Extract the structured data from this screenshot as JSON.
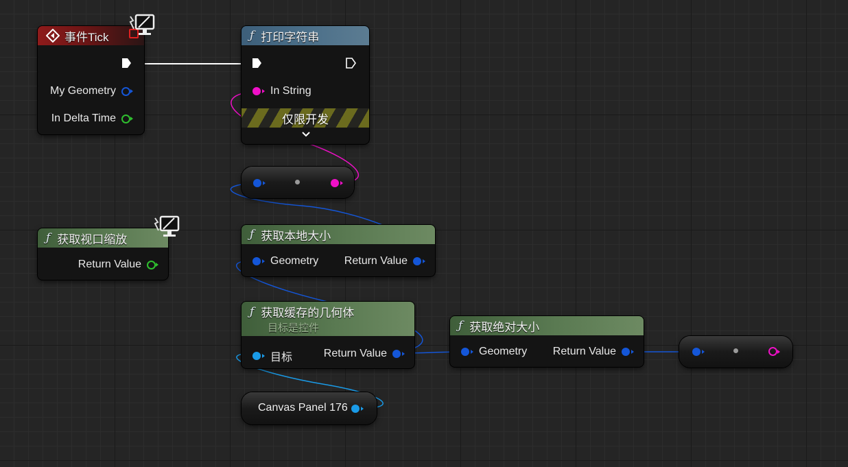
{
  "colors": {
    "exec_wire": "#ffffff",
    "string_wire": "#f010c8",
    "geometry_wire": "#1456d8",
    "object_wire": "#1a9be8",
    "float_pin": "#2fc02f"
  },
  "nodes": {
    "event_tick": {
      "title": "事件Tick",
      "icon": "event-diamond-icon",
      "pins": {
        "geometry": "My Geometry",
        "delta_time": "In Delta Time"
      }
    },
    "print_string": {
      "title": "打印字符串",
      "pins": {
        "in_string": "In String"
      },
      "dev_only_label": "仅限开发",
      "expand_icon": "chevron-down-icon"
    },
    "get_viewport_scale": {
      "title": "获取视口缩放",
      "pins": {
        "return_value": "Return Value"
      }
    },
    "get_local_size": {
      "title": "获取本地大小",
      "pins": {
        "geometry": "Geometry",
        "return_value": "Return Value"
      }
    },
    "get_cached_geometry": {
      "title": "获取缓存的几何体",
      "subtitle": "目标是控件",
      "pins": {
        "target": "目标",
        "return_value": "Return Value"
      }
    },
    "get_absolute_size": {
      "title": "获取绝对大小",
      "pins": {
        "geometry": "Geometry",
        "return_value": "Return Value"
      }
    },
    "canvas_panel_var": {
      "label": "Canvas Panel 176"
    }
  }
}
